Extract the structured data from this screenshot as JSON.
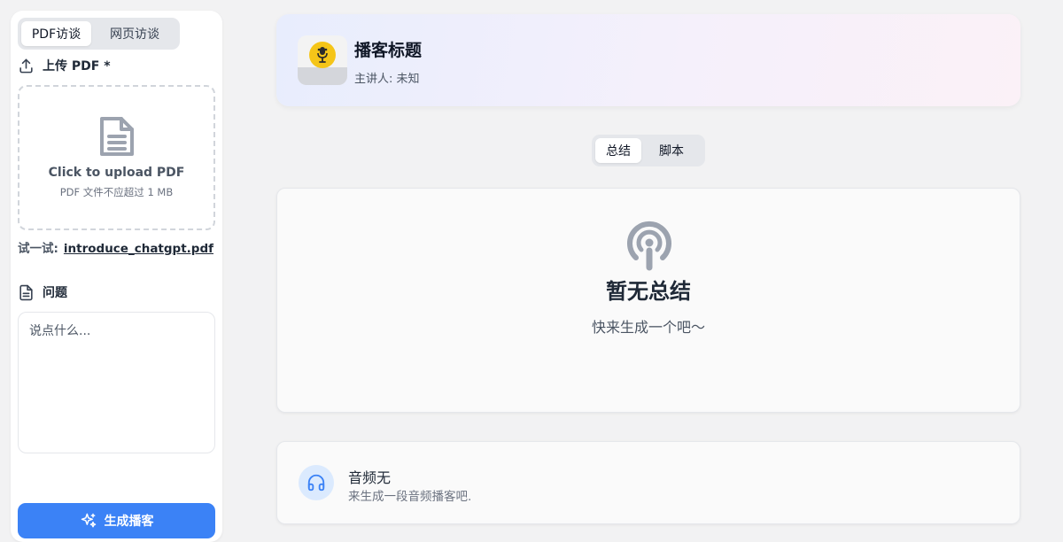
{
  "sidebar": {
    "mode_tabs": [
      {
        "label": "PDF访谈",
        "active": true
      },
      {
        "label": "网页访谈",
        "active": false
      }
    ],
    "upload_label": "上传 PDF *",
    "upload_box": {
      "title": "Click to upload PDF",
      "hint": "PDF 文件不应超过 1 MB"
    },
    "try_prefix": "试一试:",
    "try_link": "introduce_chatgpt.pdf",
    "question_label": "问题",
    "question_placeholder": "说点什么...",
    "generate_button": "生成播客"
  },
  "header": {
    "title": "播客标题",
    "host": "主讲人: 未知"
  },
  "content_tabs": [
    {
      "label": "总结",
      "active": true
    },
    {
      "label": "脚本",
      "active": false
    }
  ],
  "summary": {
    "empty_title": "暂无总结",
    "empty_subtitle": "快来生成一个吧～"
  },
  "audio": {
    "title": "音频无",
    "subtitle": "来生成一段音频播客吧."
  },
  "icons": {
    "upload": "upload-icon",
    "document": "document-icon",
    "note": "note-icon",
    "sparkles": "sparkles-icon",
    "podcast": "podcast-icon",
    "headphones": "headphones-icon"
  },
  "colors": {
    "primary": "#3b82f6",
    "accent_light": "#dbeafe",
    "avatar_disc": "#f5c518"
  }
}
